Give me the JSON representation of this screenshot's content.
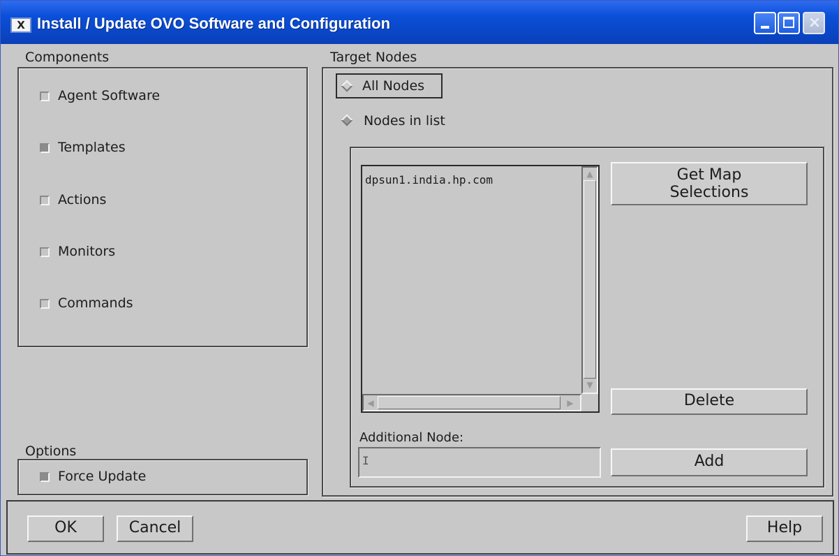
{
  "window": {
    "title": "Install / Update OVO Software and Configuration",
    "icon_text": "X",
    "accent": "#0a4fd8"
  },
  "components": {
    "heading": "Components",
    "items": [
      {
        "label": "Agent Software",
        "checked": false
      },
      {
        "label": "Templates",
        "checked": true
      },
      {
        "label": "Actions",
        "checked": false
      },
      {
        "label": "Monitors",
        "checked": false
      },
      {
        "label": "Commands",
        "checked": false
      }
    ]
  },
  "options": {
    "heading": "Options",
    "force_update": {
      "label": "Force Update",
      "checked": true
    }
  },
  "target_nodes": {
    "heading": "Target Nodes",
    "all_nodes": {
      "label": "All Nodes",
      "selected": true
    },
    "nodes_in_list": {
      "label": "Nodes in list",
      "selected": false
    },
    "node_list": [
      "dpsun1.india.hp.com"
    ],
    "get_map_selections_label": "Get Map\nSelections",
    "delete_label": "Delete",
    "additional_node_label": "Additional Node:",
    "additional_node_value": "",
    "add_label": "Add"
  },
  "footer": {
    "ok_label": "OK",
    "cancel_label": "Cancel",
    "help_label": "Help"
  }
}
